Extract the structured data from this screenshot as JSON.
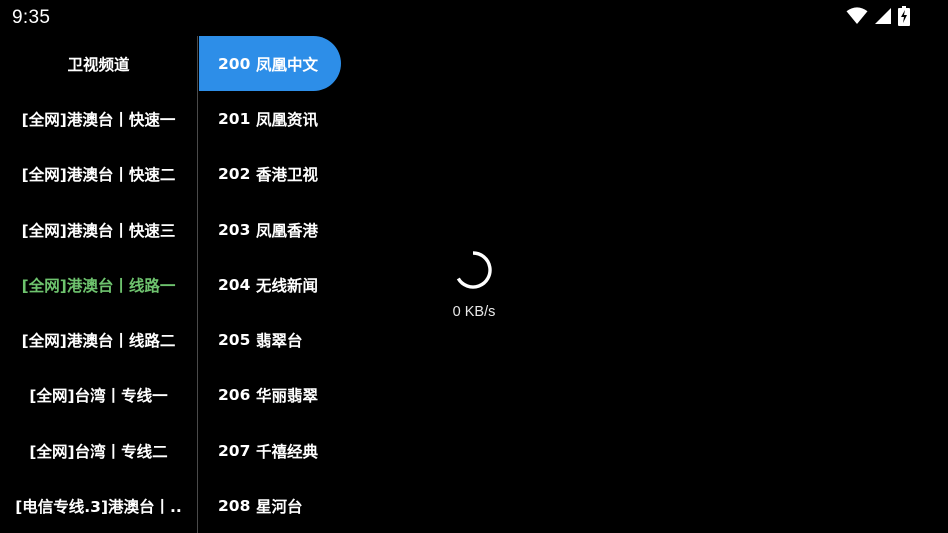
{
  "status_bar": {
    "time": "9:35",
    "icons": [
      "wifi-icon",
      "cellular-signal-icon",
      "battery-charging-icon"
    ]
  },
  "categories": {
    "items": [
      {
        "label": "卫视频道"
      },
      {
        "label": "[全网]港澳台丨快速一"
      },
      {
        "label": "[全网]港澳台丨快速二"
      },
      {
        "label": "[全网]港澳台丨快速三"
      },
      {
        "label": "[全网]港澳台丨线路一"
      },
      {
        "label": "[全网]港澳台丨线路二"
      },
      {
        "label": "[全网]台湾丨专线一"
      },
      {
        "label": "[全网]台湾丨专线二"
      },
      {
        "label": "[电信专线.3]港澳台丨.."
      }
    ],
    "active_color": "#6ec36e"
  },
  "channels": {
    "items": [
      {
        "number": "200",
        "name": "凤凰中文"
      },
      {
        "number": "201",
        "name": "凤凰资讯"
      },
      {
        "number": "202",
        "name": "香港卫视"
      },
      {
        "number": "203",
        "name": "凤凰香港"
      },
      {
        "number": "204",
        "name": "无线新闻"
      },
      {
        "number": "205",
        "name": "翡翠台"
      },
      {
        "number": "206",
        "name": "华丽翡翠"
      },
      {
        "number": "207",
        "name": "千禧经典"
      },
      {
        "number": "208",
        "name": "星河台"
      }
    ],
    "selected_color": "#2d8ee8"
  },
  "player": {
    "loading_icon": "loading-spinner-icon",
    "speed": "0 KB/s"
  }
}
